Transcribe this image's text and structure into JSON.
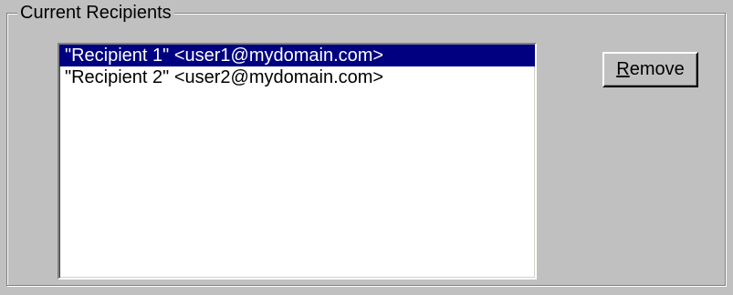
{
  "group": {
    "legend": "Current Recipients"
  },
  "recipients": [
    {
      "text": "\"Recipient 1\" <user1@mydomain.com>",
      "selected": true
    },
    {
      "text": "\"Recipient 2\" <user2@mydomain.com>",
      "selected": false
    }
  ],
  "remove_button": {
    "accel": "R",
    "rest": "emove"
  },
  "colors": {
    "face": "#c0c0c0",
    "selection": "#000080",
    "selection_text": "#ffffff"
  }
}
